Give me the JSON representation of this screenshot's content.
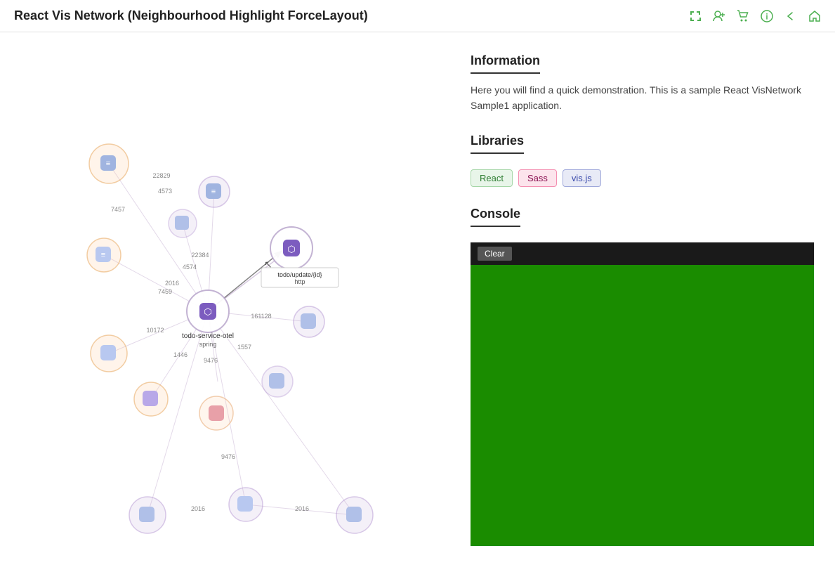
{
  "header": {
    "title": "React Vis Network (Neighbourhood Highlight ForceLayout)",
    "icons": [
      "fullscreen-icon",
      "user-add-icon",
      "cart-icon",
      "info-icon",
      "back-icon",
      "home-icon"
    ]
  },
  "info": {
    "section_title": "Information",
    "description": "Here you will find a quick demonstration. This is a sample React VisNetwork Sample1 application."
  },
  "libraries": {
    "section_title": "Libraries",
    "badges": [
      {
        "label": "React",
        "class": "badge-react"
      },
      {
        "label": "Sass",
        "class": "badge-sass"
      },
      {
        "label": "vis.js",
        "class": "badge-visjs"
      }
    ]
  },
  "console": {
    "section_title": "Console",
    "clear_label": "Clear"
  },
  "graph": {
    "tooltip_label": "todo/update/{id}",
    "tooltip_sub": "http",
    "center_node_label": "todo-service-otel",
    "center_node_sub": "spring",
    "edges": [
      {
        "from": "22829",
        "label": "22829"
      },
      {
        "from": "4573",
        "label": "4573"
      },
      {
        "from": "2016a",
        "label": "2016"
      },
      {
        "from": "7457",
        "label": "7457"
      },
      {
        "from": "22384",
        "label": "22384"
      },
      {
        "from": "4574",
        "label": "4574"
      },
      {
        "from": "2016b",
        "label": "2016"
      },
      {
        "from": "7459",
        "label": "7459"
      },
      {
        "from": "10172",
        "label": "10172"
      },
      {
        "from": "161128",
        "label": "161128"
      },
      {
        "from": "1446",
        "label": "1446"
      },
      {
        "from": "9476a",
        "label": "9476"
      },
      {
        "from": "1557",
        "label": "1557"
      },
      {
        "from": "9476b",
        "label": "9476"
      },
      {
        "from": "2016c",
        "label": "2016"
      },
      {
        "from": "9476c",
        "label": "9476"
      }
    ]
  }
}
